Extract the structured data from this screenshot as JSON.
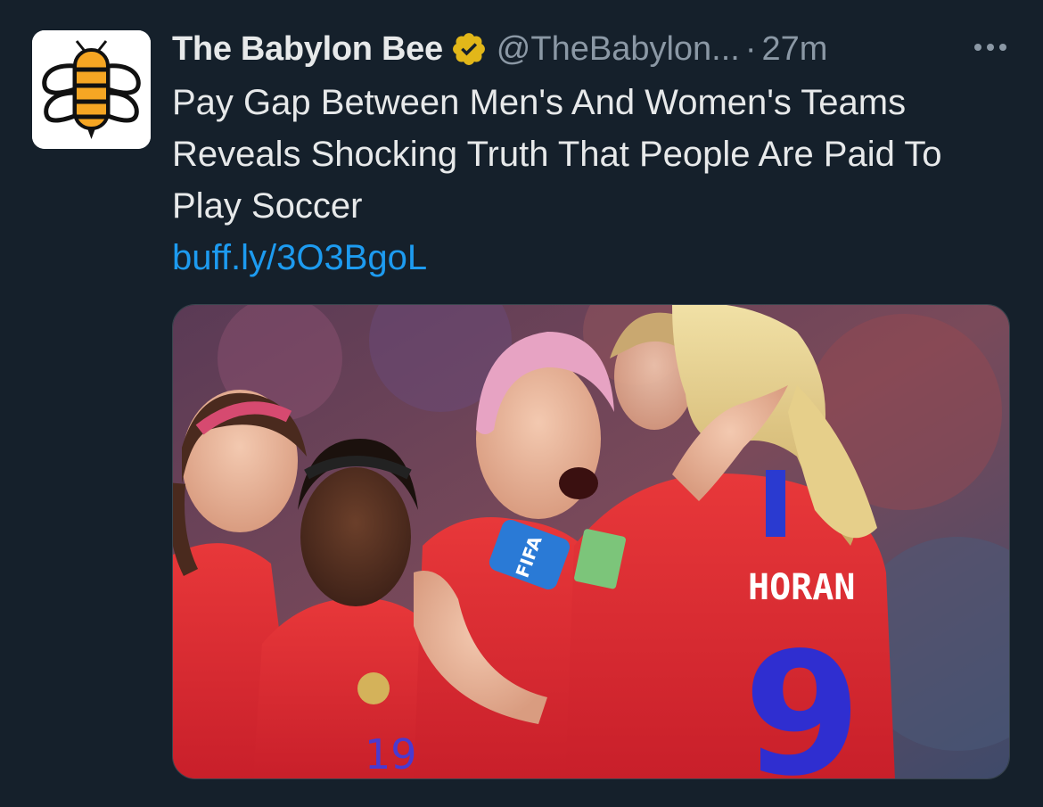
{
  "tweet": {
    "author_name": "The Babylon Bee",
    "handle": "@TheBabylon...",
    "separator": "·",
    "time": "27m",
    "verified_icon": "gold-verified-badge-icon",
    "more_icon": "more-options-icon",
    "text": "Pay Gap Between Men's And Women's Teams Reveals Shocking Truth That People Are Paid To Play Soccer",
    "link": "buff.ly/3O3BgoL",
    "media": {
      "jersey_name": "HORAN",
      "jersey_number": "9",
      "other_jersey_number": "19",
      "armband_text": "FIFA"
    }
  },
  "colors": {
    "background": "#15202b",
    "text": "#e7e9ea",
    "muted": "#8b98a5",
    "link": "#1d9bf0",
    "verified": "#e2b719"
  }
}
